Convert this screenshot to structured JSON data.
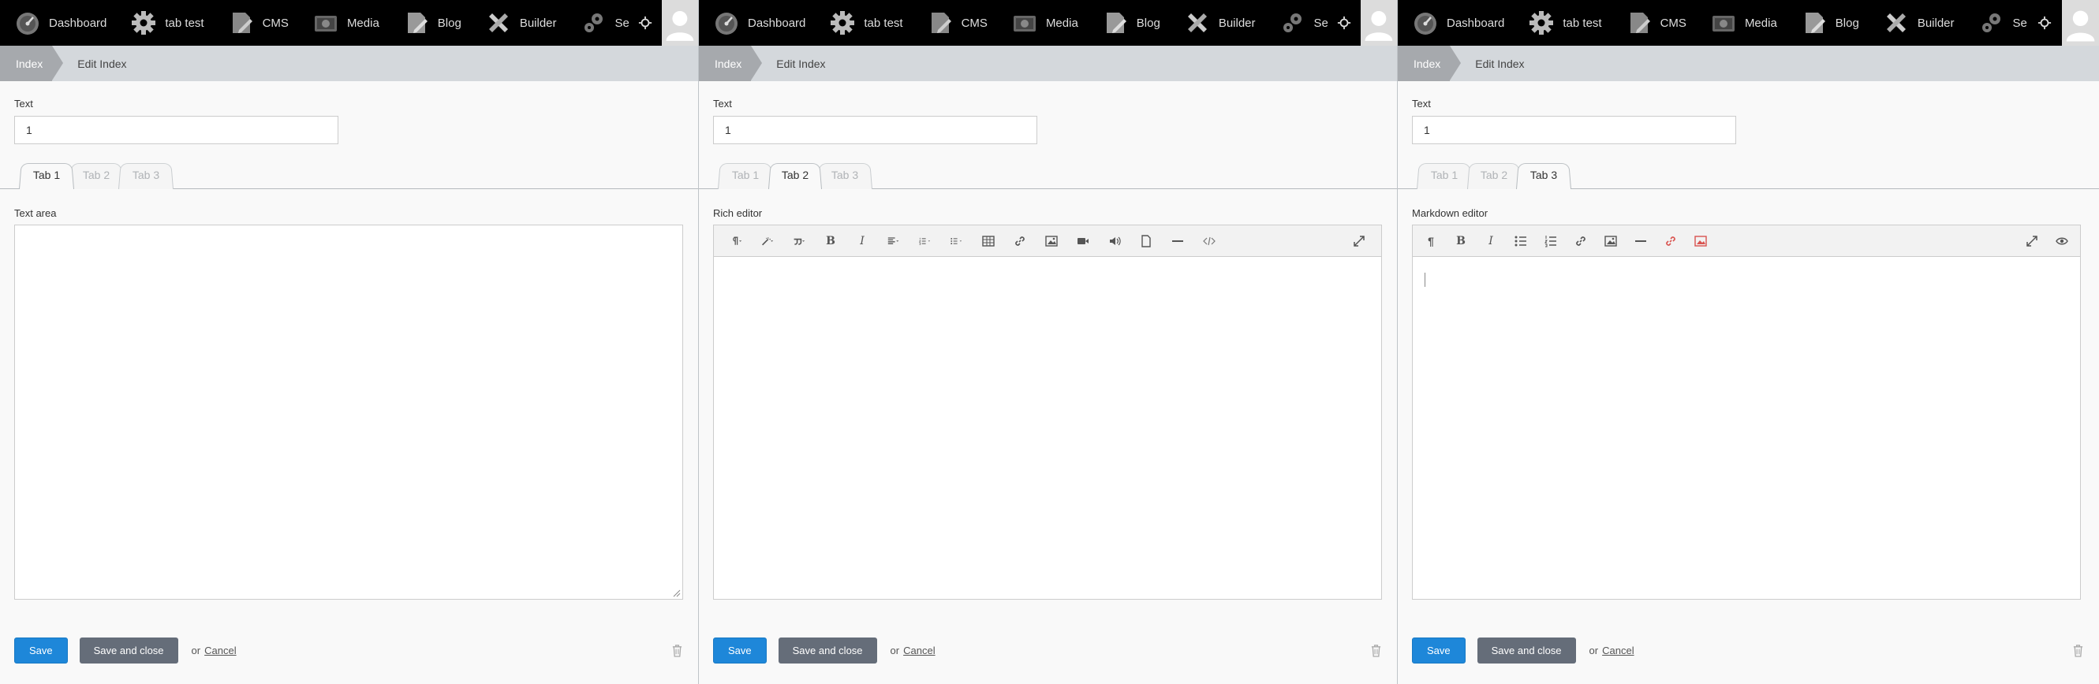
{
  "nav": {
    "items": [
      {
        "label": "Dashboard",
        "icon": "dashboard-icon"
      },
      {
        "label": "tab test",
        "icon": "gear-icon"
      },
      {
        "label": "CMS",
        "icon": "cms-icon"
      },
      {
        "label": "Media",
        "icon": "media-icon"
      },
      {
        "label": "Blog",
        "icon": "blog-icon"
      },
      {
        "label": "Builder",
        "icon": "builder-icon"
      },
      {
        "label": "Se",
        "icon": "settings-icon"
      }
    ],
    "preview_icon": "crosshair-icon",
    "avatar_icon": "user-avatar-icon"
  },
  "breadcrumb": {
    "root": "Index",
    "current": "Edit Index"
  },
  "form": {
    "text_label": "Text",
    "text_value": "1",
    "tabs": [
      "Tab 1",
      "Tab 2",
      "Tab 3"
    ],
    "panels": [
      {
        "active_tab": 0,
        "section_label": "Text area",
        "editor": "textarea"
      },
      {
        "active_tab": 1,
        "section_label": "Rich editor",
        "editor": "rich"
      },
      {
        "active_tab": 2,
        "section_label": "Markdown editor",
        "editor": "markdown"
      }
    ]
  },
  "footer": {
    "save": "Save",
    "save_close": "Save and close",
    "or": "or",
    "cancel": "Cancel"
  },
  "colors": {
    "primary": "#1e87d9",
    "secondary": "#656d79",
    "nav_bg": "#000000",
    "breadcrumb_bg": "#d4d8dc",
    "markdown_link_red": "#d9534f"
  }
}
